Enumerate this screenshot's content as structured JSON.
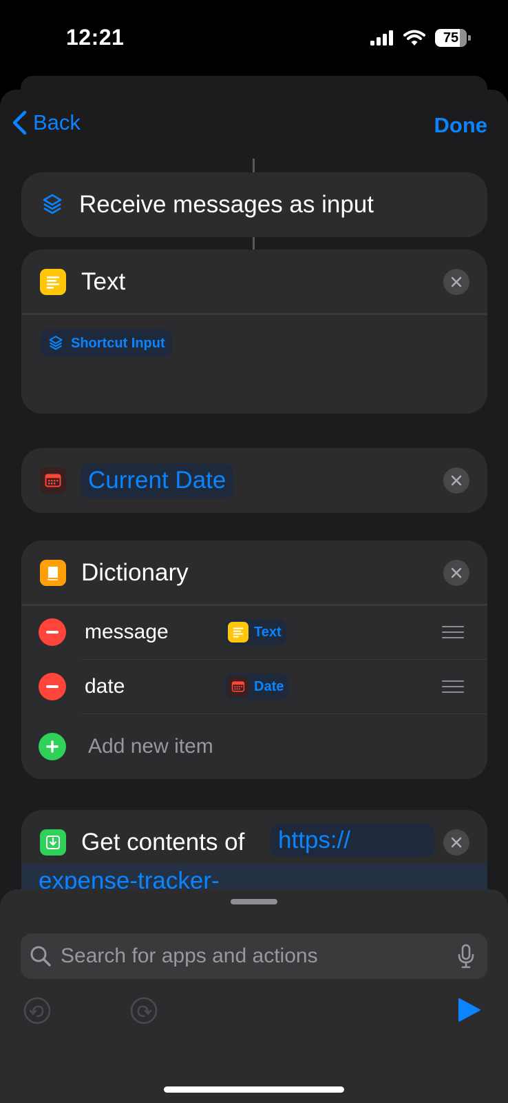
{
  "status": {
    "time": "12:21",
    "battery": "75"
  },
  "nav": {
    "back_label": "Back",
    "done_label": "Done"
  },
  "actions": {
    "receive": {
      "label": "Receive messages as input"
    },
    "text": {
      "title": "Text",
      "token": "Shortcut Input"
    },
    "current_date": {
      "token": "Current Date"
    },
    "dictionary": {
      "title": "Dictionary",
      "items": [
        {
          "key": "message",
          "value": "Text"
        },
        {
          "key": "date",
          "value": "Date"
        }
      ],
      "add_label": "Add new item"
    },
    "get_contents": {
      "title": "Get contents of",
      "url_part1": "https://",
      "url_part2": "expense-tracker-"
    }
  },
  "search": {
    "placeholder": "Search for apps and actions"
  },
  "colors": {
    "accent": "#0a84ff",
    "text_icon": "#ffc60a",
    "dictionary_icon": "#ff9f0a",
    "date_icon": "#ff453a",
    "download_icon": "#30d158",
    "sheet_bg": "#1c1c1e",
    "card_bg": "#2c2c2e"
  }
}
